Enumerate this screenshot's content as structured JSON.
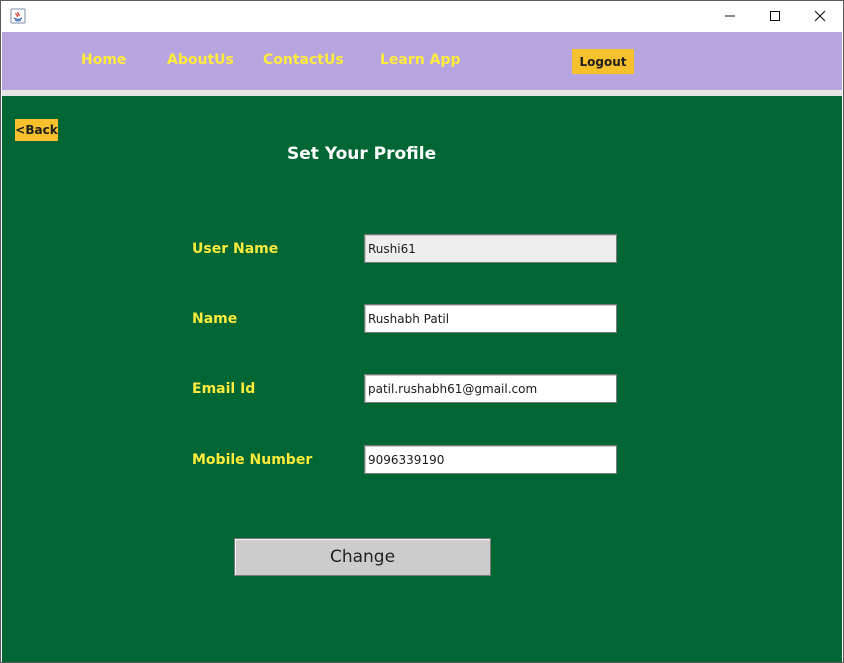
{
  "window": {
    "controls": {
      "minimize_icon": "minimize-icon",
      "maximize_icon": "maximize-icon",
      "close_icon": "close-icon"
    }
  },
  "nav": {
    "items": [
      {
        "label": "Home"
      },
      {
        "label": "AboutUs"
      },
      {
        "label": "ContactUs"
      },
      {
        "label": "Learn App"
      }
    ],
    "logout_label": "Logout",
    "background": "#b7a5df",
    "link_color": "#ffeb3b"
  },
  "page": {
    "back_label": "<Back",
    "title": "Set Your Profile",
    "background": "#006633"
  },
  "form": {
    "fields": [
      {
        "label": "User Name",
        "value": "Rushi61",
        "editable": false
      },
      {
        "label": "Name",
        "value": "Rushabh Patil",
        "editable": true
      },
      {
        "label": "Email Id",
        "value": "patil.rushabh61@gmail.com",
        "editable": true
      },
      {
        "label": "Mobile Number",
        "value": "9096339190",
        "editable": true
      }
    ],
    "submit_label": "Change",
    "accent": "#f6c12c"
  }
}
